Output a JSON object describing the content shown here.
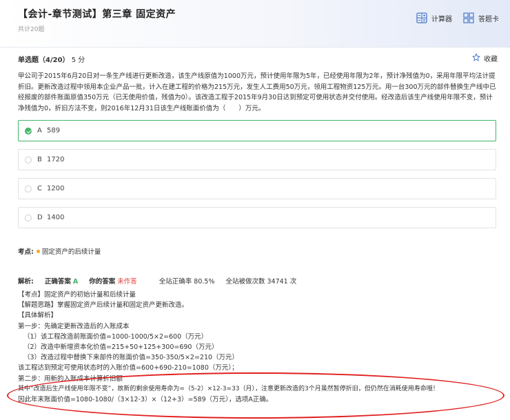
{
  "header": {
    "title": "【会计-章节测试】第三章 固定资产",
    "subtitle": "共计20题",
    "calculator_label": "计算器",
    "answer_card_label": "答题卡"
  },
  "question": {
    "type_label": "单选题（4/20）",
    "score": "5 分",
    "favorite_label": "收藏",
    "stem": "甲公司于2015年6月20日对一条生产线进行更新改造，该生产线原值为1000万元，预计使用年限为5年，已经使用年限为2年，预计净残值为0，采用年限平均法计提折旧。更新改造过程中领用本企业产品一批，计入在建工程的价格为215万元，发生人工费用50万元，领用工程物资125万元。用一台300万元的部件替换生产线中已经报废的部件账面原值350万元（已无使用价值，残值为0）。该改造工程于2015年9月30日达到预定可使用状态并交付使用。经改造后该生产线使用年限不变，预计净残值为0，折旧方法不变，则2016年12月31日该生产线账面价值为（　　）万元。",
    "options": [
      {
        "letter": "A",
        "text": "589"
      },
      {
        "letter": "B",
        "text": "1720"
      },
      {
        "letter": "C",
        "text": "1200"
      },
      {
        "letter": "D",
        "text": "1400"
      }
    ]
  },
  "knowledge": {
    "label": "考点:",
    "point": "固定资产的后续计量"
  },
  "analysis": {
    "label": "解析:",
    "correct_label": "正确答案",
    "correct_value": "A",
    "your_label": "你的答案",
    "your_value": "未作答",
    "accuracy": "全站正确率 80.5%",
    "attempts": "全站被做次数 34741 次",
    "lines": [
      "【考点】固定资产的初始计量和后续计量",
      "【解题思路】掌握固定资产后续计量和固定资产更新改造。",
      "【具体解析】",
      "第一步：先确定更新改造后的入账成本",
      "（1）该工程改造前账面价值=1000-1000/5×2=600（万元）",
      "（2）改造中新增资本化价值=215+50+125+300=690（万元）",
      "（3）改造过程中替换下来部件的账面价值=350-350/5×2=210（万元）",
      "该工程达到预定可使用状态时的入账价值=600+690-210=1080（万元）；",
      "第二步：用新的入账成本计算折旧额",
      "其中“改造后生产线使用年限不变”，故新的剩余使用寿命为=（5-2）×12-3=33（月），注意更新改造的3个月虽然暂停折旧，但仍然在消耗使用寿命哦！",
      "因此年末账面价值=1080-1080/（3×12-3）×（12+3）=589（万元），选项A正确。"
    ]
  },
  "colors": {
    "correct": "#43b36a",
    "unanswered": "#e53935",
    "annotation": "#e02020",
    "tag_dot": "#f5a623"
  }
}
